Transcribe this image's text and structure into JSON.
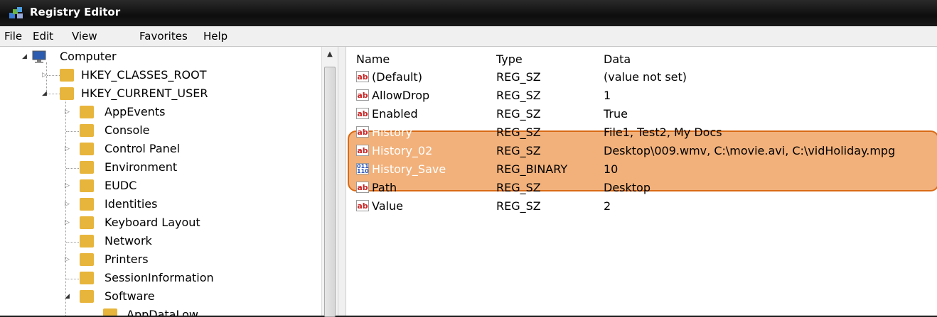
{
  "window": {
    "title": "Registry Editor"
  },
  "menu": [
    "File",
    "Edit",
    "View",
    "Favorites",
    "Help"
  ],
  "tree": {
    "root": "Computer",
    "hives": [
      "HKEY_CLASSES_ROOT",
      "HKEY_CURRENT_USER"
    ],
    "hkcu_children": [
      "AppEvents",
      "Console",
      "Control Panel",
      "Environment",
      "EUDC",
      "Identities",
      "Keyboard Layout",
      "Network",
      "Printers",
      "SessionInformation",
      "Software"
    ],
    "partial": "AppDataLow"
  },
  "columns": {
    "name": "Name",
    "type": "Type",
    "data": "Data"
  },
  "values": [
    {
      "name": "(Default)",
      "type": "REG_SZ",
      "data": "(value not set)",
      "icon": "ab"
    },
    {
      "name": "AllowDrop",
      "type": "REG_SZ",
      "data": "1",
      "icon": "ab"
    },
    {
      "name": "Enabled",
      "type": "REG_SZ",
      "data": "True",
      "icon": "ab"
    },
    {
      "name": "History",
      "type": "REG_SZ",
      "data": "File1, Test2, My Docs",
      "icon": "ab"
    },
    {
      "name": "History_02",
      "type": "REG_SZ",
      "data": "Desktop\\009.wmv, C:\\movie.avi, C:\\vidHoliday.mpg",
      "icon": "ab"
    },
    {
      "name": "History_Save",
      "type": "REG_BINARY",
      "data": "10",
      "icon": "bin"
    },
    {
      "name": "Path",
      "type": "REG_SZ",
      "data": "Desktop",
      "icon": "ab"
    },
    {
      "name": "Value",
      "type": "REG_SZ",
      "data": "2",
      "icon": "ab"
    }
  ],
  "icon_glyphs": {
    "ab": "ab",
    "bin": "011\n110"
  },
  "colors": {
    "highlight": "#ec8c3c",
    "folder": "#e8b53c"
  }
}
